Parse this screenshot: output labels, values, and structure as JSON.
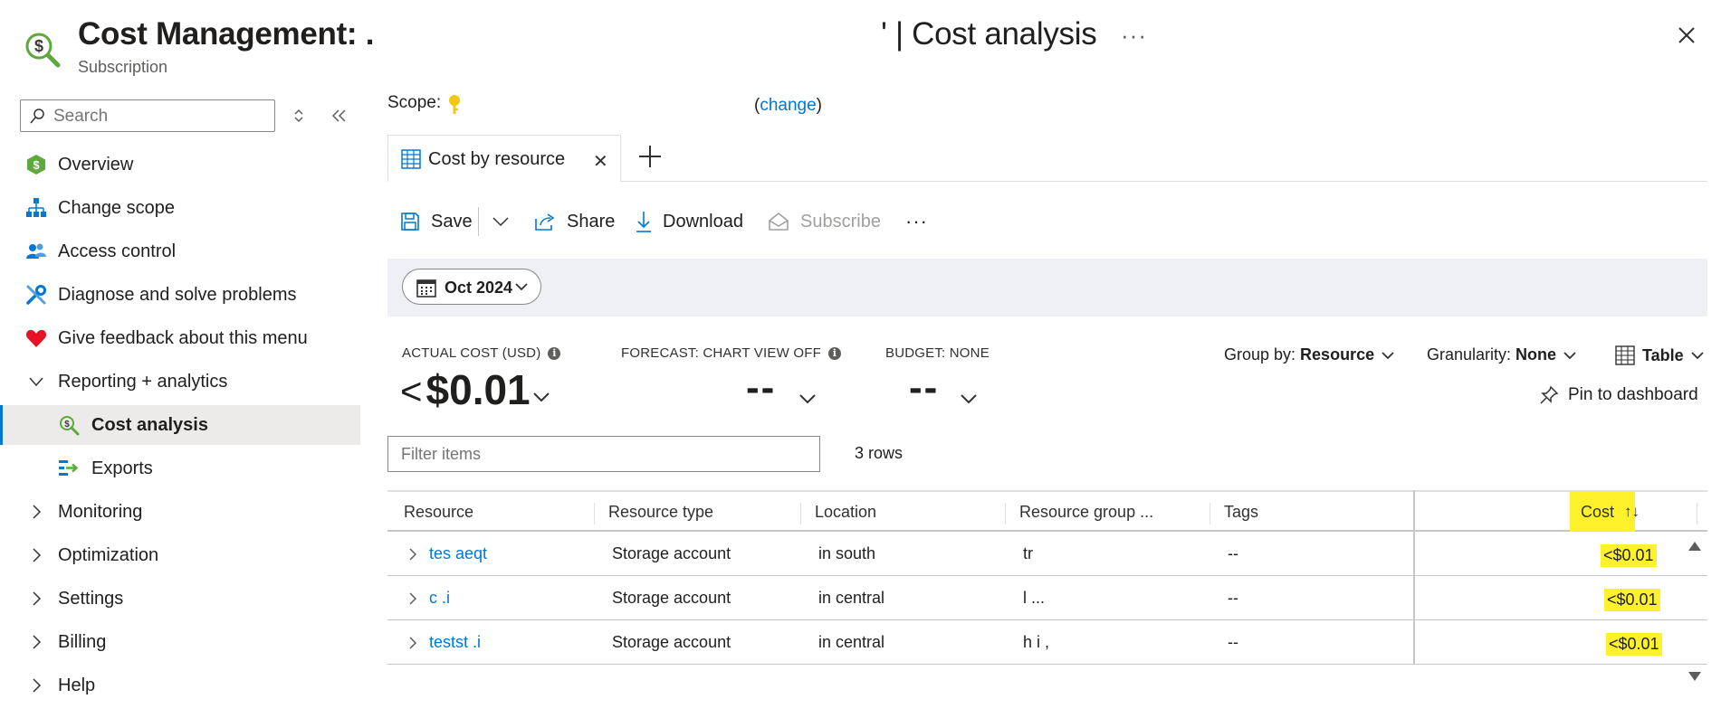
{
  "header": {
    "title_prefix": "Cost Management: .",
    "title_suffix": "' | Cost analysis",
    "subtitle": "Subscription",
    "more": "···"
  },
  "sidebar": {
    "search_placeholder": "Search",
    "items": [
      {
        "label": "Overview",
        "icon": "overview-hex-icon"
      },
      {
        "label": "Change scope",
        "icon": "hierarchy-icon"
      },
      {
        "label": "Access control",
        "icon": "people-icon"
      },
      {
        "label": "Diagnose and solve problems",
        "icon": "wrench-icon"
      },
      {
        "label": "Give feedback about this menu",
        "icon": "heart-icon"
      },
      {
        "label": "Reporting + analytics",
        "expanded": true
      },
      {
        "label": "Cost analysis",
        "icon": "cost-analysis-icon",
        "active": true
      },
      {
        "label": "Exports",
        "icon": "exports-icon"
      },
      {
        "label": "Monitoring"
      },
      {
        "label": "Optimization"
      },
      {
        "label": "Settings"
      },
      {
        "label": "Billing"
      },
      {
        "label": "Help"
      }
    ]
  },
  "scope": {
    "label": "Scope:",
    "change_prefix": "(",
    "change_link": "change",
    "change_suffix": ")"
  },
  "tabs": [
    {
      "label": "Cost by resource",
      "active": true
    }
  ],
  "toolbar": {
    "save": "Save",
    "share": "Share",
    "download": "Download",
    "subscribe": "Subscribe",
    "more": "···"
  },
  "date_filter": "Oct 2024",
  "kpis": {
    "actual_label": "ACTUAL COST (USD)",
    "actual_lt": "<",
    "actual_value": "$0.01",
    "forecast_label": "FORECAST: CHART VIEW OFF",
    "forecast_value": "--",
    "budget_label": "BUDGET: NONE",
    "budget_value": "--"
  },
  "controls": {
    "group_by_label": "Group by:",
    "group_by_value": "Resource",
    "granularity_label": "Granularity:",
    "granularity_value": "None",
    "view_value": "Table",
    "pin": "Pin to dashboard"
  },
  "filter": {
    "placeholder": "Filter items",
    "rows_count": "3 rows"
  },
  "table": {
    "columns": [
      "Resource",
      "Resource type",
      "Location",
      "Resource group ...",
      "Tags",
      "Cost"
    ],
    "sort_arrows": "↑↓",
    "rows": [
      {
        "resource": "tes      aeqt",
        "type": "Storage account",
        "location": "in south",
        "group": "tr",
        "tags": "--",
        "cost": "<$0.01"
      },
      {
        "resource": "c            .i",
        "type": "Storage account",
        "location": "in central",
        "group": "l   ...",
        "tags": "--",
        "cost": "<$0.01"
      },
      {
        "resource": "testst      .i",
        "type": "Storage account",
        "location": "in central",
        "group": "h  i  ,",
        "tags": "--",
        "cost": "<$0.01"
      }
    ]
  },
  "colors": {
    "accent": "#0078d4",
    "highlight": "#fcf12a",
    "active_nav_bg": "#edebe9",
    "band_bg": "#eff0f6"
  }
}
